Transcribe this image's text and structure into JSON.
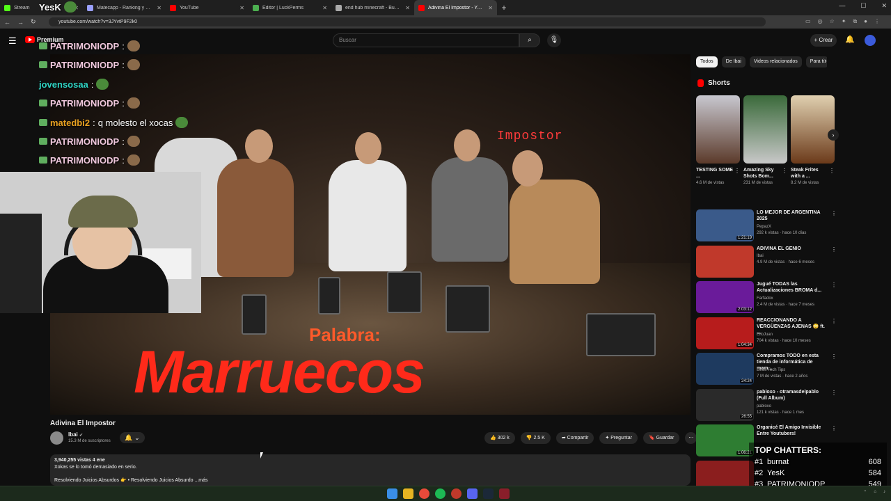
{
  "browser": {
    "tabs": [
      {
        "title": "Stream",
        "color": "#53fc18"
      },
      {
        "title": "Matecapp - Ranking y Racha d",
        "color": "#9aa0ff"
      },
      {
        "title": "YouTube",
        "color": "#ff0000"
      },
      {
        "title": "Editor | LuckPerms",
        "color": "#4caf50"
      },
      {
        "title": "end hub minecraft - Buscar con",
        "color": "#aaaaaa"
      },
      {
        "title": "Adivina El Impostor - YouTu",
        "color": "#ff0000",
        "active": true
      }
    ],
    "url": "youtube.com/watch?v=3JYvtP9F2k0"
  },
  "header": {
    "logo": "Premium",
    "search_placeholder": "Buscar",
    "create_label": "+ Crear"
  },
  "video": {
    "impostor_label": "Impostor",
    "palabra_label": "Palabra:",
    "word": "Marruecos",
    "title": "Adivina El Impostor",
    "channel": "Ibai",
    "subscribers": "15.3 M de suscriptores",
    "likes": "302 k",
    "dislikes": "2.5 K",
    "share": "Compartir",
    "ask": "Preguntar",
    "save": "Guardar",
    "desc_meta": "3,940,255 vistas  4 ene",
    "desc_line1": "Xokas se lo tomó demasiado en serio.",
    "desc_line2": "Resolviendo Juicios Absurdos 👉 • Resolviendo Juicios Absurdo ...más"
  },
  "sidebar": {
    "chips": [
      "Todos",
      "De Ibai",
      "Videos relacionados",
      "Para ti"
    ],
    "shorts_title": "Shorts",
    "shorts": [
      {
        "title": "TESTING SOME ...",
        "views": "4.6 M de vistas",
        "color": "#5b3a2a"
      },
      {
        "title": "Amazing Sky Shots Bom...",
        "views": "231 M de vistas",
        "color": "#7a8a7a"
      },
      {
        "title": "Steak Frites with a ...",
        "views": "8.2 M de vistas",
        "color": "#6b4a2a"
      }
    ],
    "recs": [
      {
        "title": "LO MEJOR DE ARGENTINA 2025",
        "channel": "PepazX",
        "views": "292 k vistas · hace 10 días",
        "duration": "1:21:19",
        "color": "#3a5a8a"
      },
      {
        "title": "ADIVINA EL GENIO",
        "channel": "Ibai",
        "views": "4.9 M de vistas · hace 6 meses",
        "duration": "",
        "color": "#c0392b"
      },
      {
        "title": "Jugué TODAS las Actualizaciones BROMA d...",
        "channel": "Farfadox",
        "views": "2.4 M de vistas · hace 7 meses",
        "duration": "2:03:12",
        "color": "#6a1b9a"
      },
      {
        "title": "REACCIONANDO A VERGÜENZAS AJENAS 😳 ft. ...",
        "channel": "ElloJuan",
        "views": "704 k vistas · hace 10 meses",
        "duration": "1:04:34",
        "color": "#b71c1c"
      },
      {
        "title": "Compramos TODO en esta tienda de informática de mam...",
        "channel": "Linus Tech Tips",
        "views": "7 M de vistas · hace 2 años",
        "duration": "24:24",
        "color": "#1e3a5f"
      },
      {
        "title": "pabloxo - otramasdelpablo (Full Album)",
        "channel": "pabloxo",
        "views": "121 k vistas · hace 1 mes",
        "duration": "26:55",
        "color": "#2a2a2a"
      },
      {
        "title": "Organicé El Amigo Invisible Entre Youtubers!",
        "channel": "",
        "views": "",
        "duration": "1:06:21",
        "color": "#2e7d32"
      },
      {
        "title": "",
        "channel": "",
        "views": "",
        "duration": "",
        "color": "#8b1e1e"
      }
    ]
  },
  "chat": [
    {
      "user": "YesK",
      "text": "",
      "color": "#ffffff"
    },
    {
      "user": "PATRIMONIODP",
      "text": "",
      "color": "#f0c8dd"
    },
    {
      "user": "PATRIMONIODP",
      "text": "",
      "color": "#f0c8dd"
    },
    {
      "user": "jovensosaa",
      "text": "",
      "color": "#2fd4c4"
    },
    {
      "user": "PATRIMONIODP",
      "text": "",
      "color": "#f0c8dd"
    },
    {
      "user": "matedbi2",
      "text": "q molesto el xocas",
      "color": "#e8a020"
    },
    {
      "user": "PATRIMONIODP",
      "text": "",
      "color": "#f0c8dd"
    },
    {
      "user": "PATRIMONIODP",
      "text": "",
      "color": "#f0c8dd"
    }
  ],
  "topchatters": {
    "title": "TOP CHATTERS:",
    "rows": [
      {
        "rank": "#1",
        "name": "burnat",
        "count": "608"
      },
      {
        "rank": "#2",
        "name": "YesK",
        "count": "584"
      },
      {
        "rank": "#3",
        "name": "PATRIMONIODP",
        "count": "549"
      }
    ]
  }
}
